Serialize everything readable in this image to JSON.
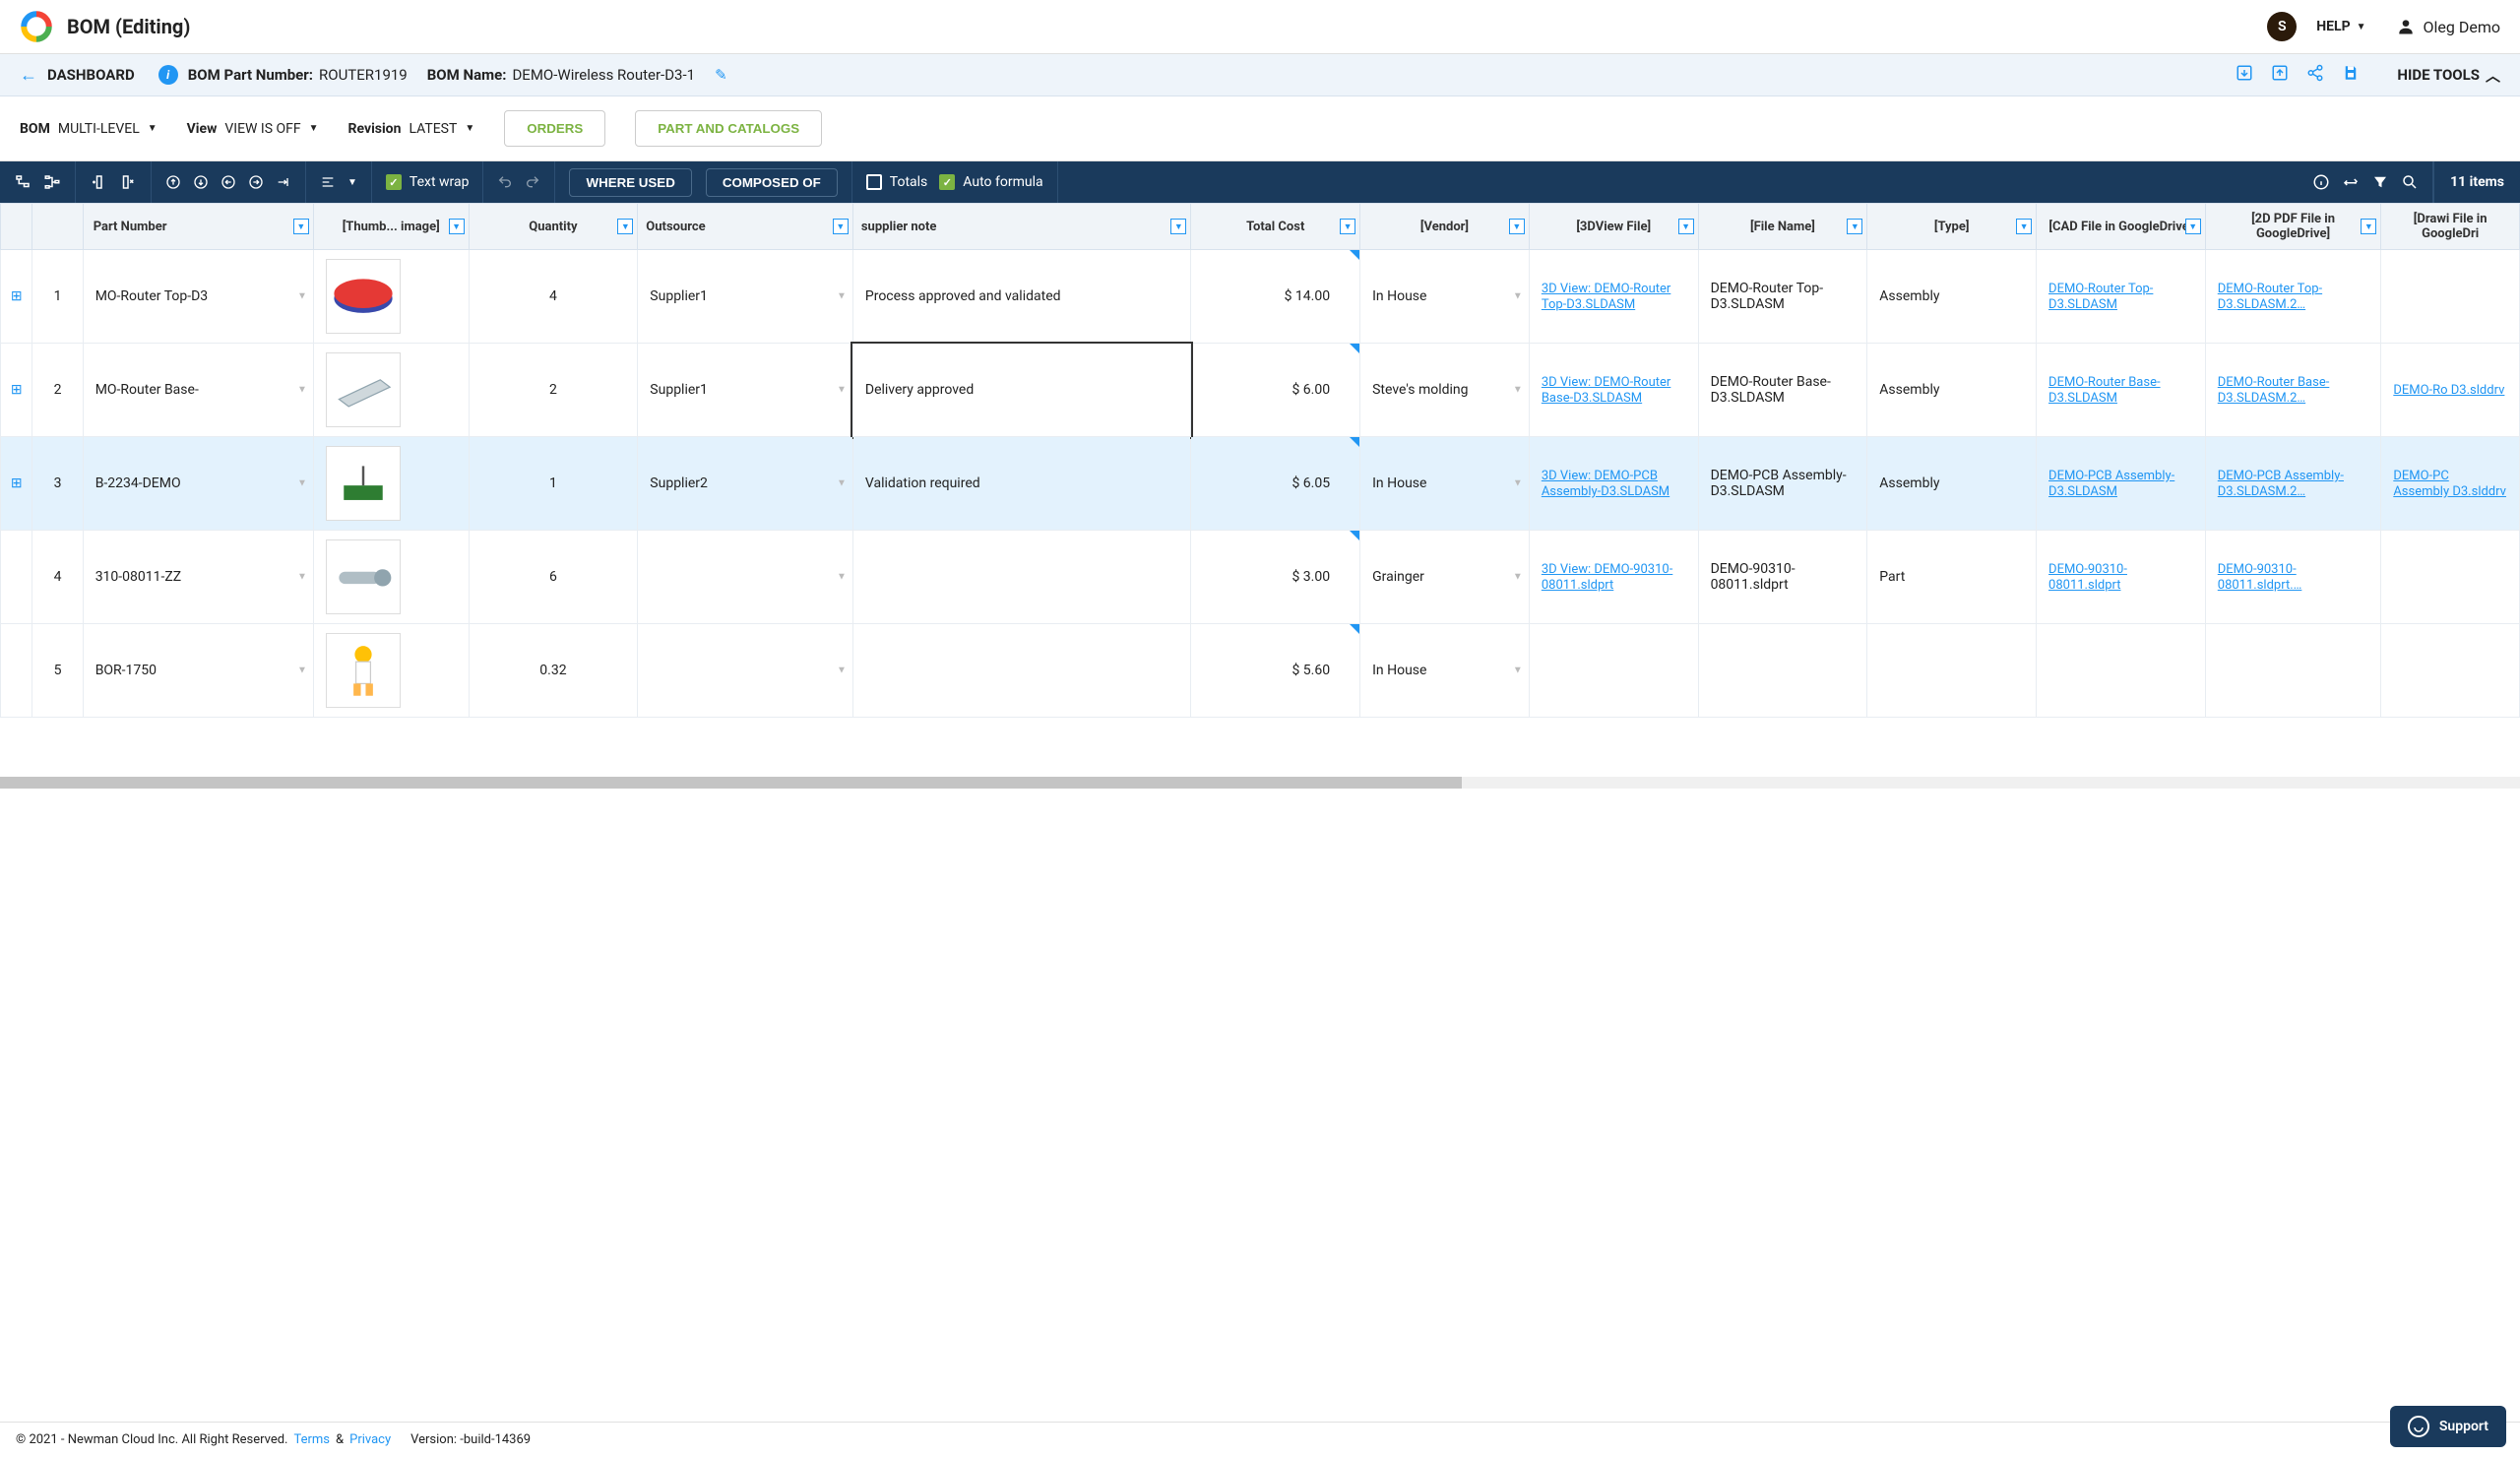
{
  "header": {
    "title": "BOM (Editing)",
    "avatar_initial": "S",
    "help_label": "HELP",
    "user_name": "Oleg Demo"
  },
  "breadcrumb": {
    "dashboard": "DASHBOARD",
    "bom_pn_label": "BOM Part Number:",
    "bom_pn_value": "ROUTER1919",
    "bom_name_label": "BOM Name:",
    "bom_name_value": "DEMO-Wireless Router-D3-1",
    "hide_tools": "HIDE TOOLS"
  },
  "viewbar": {
    "bom_label": "BOM",
    "bom_value": "MULTI-LEVEL",
    "view_label": "View",
    "view_value": "VIEW IS OFF",
    "revision_label": "Revision",
    "revision_value": "LATEST",
    "orders_btn": "ORDERS",
    "catalogs_btn": "PART AND CATALOGS"
  },
  "toolbar": {
    "text_wrap": "Text wrap",
    "where_used": "WHERE USED",
    "composed_of": "COMPOSED OF",
    "totals": "Totals",
    "auto_formula": "Auto formula",
    "item_count": "11 items"
  },
  "columns": {
    "part_number": "Part Number",
    "thumb": "[Thumb... image]",
    "quantity": "Quantity",
    "outsource": "Outsource",
    "supplier_note": "supplier note",
    "total_cost": "Total Cost",
    "vendor": "[Vendor]",
    "view3d": "[3DView File]",
    "file_name": "[File Name]",
    "type": "[Type]",
    "cad_gdrive": "[CAD File in GoogleDrive]",
    "pdf_gdrive": "[2D PDF File in GoogleDrive]",
    "drawing_gdrive": "[Drawi File in GoogleDri"
  },
  "rows": [
    {
      "num": "1",
      "part_number": "MO-Router Top-D3",
      "quantity": "4",
      "outsource": "Supplier1",
      "supplier_note": "Process approved and validated",
      "total_cost": "$ 14.00",
      "vendor": "In House",
      "view3d": "3D View: DEMO-Router Top-D3.SLDASM",
      "file_name": "DEMO-Router Top-D3.SLDASM",
      "type": "Assembly",
      "cad_gdrive": "DEMO-Router Top-D3.SLDASM",
      "pdf_gdrive": "DEMO-Router Top-D3.SLDASM.2…",
      "drawing_gdrive": ""
    },
    {
      "num": "2",
      "part_number": "MO-Router Base-",
      "quantity": "2",
      "outsource": "Supplier1",
      "supplier_note": "Delivery approved",
      "total_cost": "$ 6.00",
      "vendor": "Steve's molding",
      "view3d": "3D View: DEMO-Router Base-D3.SLDASM",
      "file_name": "DEMO-Router Base-D3.SLDASM",
      "type": "Assembly",
      "cad_gdrive": "DEMO-Router Base-D3.SLDASM",
      "pdf_gdrive": "DEMO-Router Base-D3.SLDASM.2…",
      "drawing_gdrive": "DEMO-Ro D3.slddrv"
    },
    {
      "num": "3",
      "part_number": "B-2234-DEMO",
      "quantity": "1",
      "outsource": "Supplier2",
      "supplier_note": "Validation required",
      "total_cost": "$ 6.05",
      "vendor": "In House",
      "view3d": "3D View: DEMO-PCB Assembly-D3.SLDASM",
      "file_name": "DEMO-PCB Assembly-D3.SLDASM",
      "type": "Assembly",
      "cad_gdrive": "DEMO-PCB Assembly-D3.SLDASM",
      "pdf_gdrive": "DEMO-PCB Assembly-D3.SLDASM.2…",
      "drawing_gdrive": "DEMO-PC Assembly D3.slddrv"
    },
    {
      "num": "4",
      "part_number": "310-08011-ZZ",
      "quantity": "6",
      "outsource": "",
      "supplier_note": "",
      "total_cost": "$ 3.00",
      "vendor": "Grainger",
      "view3d": "3D View: DEMO-90310-08011.sldprt",
      "file_name": "DEMO-90310-08011.sldprt",
      "type": "Part",
      "cad_gdrive": "DEMO-90310-08011.sldprt",
      "pdf_gdrive": "DEMO-90310-08011.sldprt.…",
      "drawing_gdrive": ""
    },
    {
      "num": "5",
      "part_number": "BOR-1750",
      "quantity": "0.32",
      "outsource": "",
      "supplier_note": "",
      "total_cost": "$ 5.60",
      "vendor": "In House",
      "view3d": "",
      "file_name": "",
      "type": "",
      "cad_gdrive": "",
      "pdf_gdrive": "",
      "drawing_gdrive": ""
    }
  ],
  "footer": {
    "copyright": "© 2021 - Newman Cloud Inc. All Right Reserved.",
    "terms": "Terms",
    "and": "&",
    "privacy": "Privacy",
    "version": "Version: -build-14369",
    "support": "Support"
  }
}
